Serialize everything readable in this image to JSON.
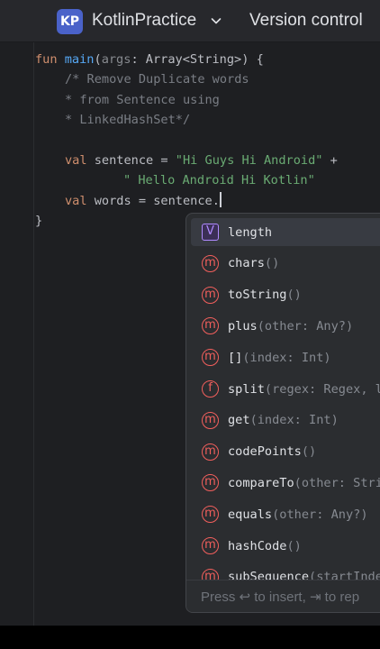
{
  "titlebar": {
    "project_badge": "KP",
    "project_name": "KotlinPractice",
    "project_chevron_icon": "chevron-down-icon",
    "vcs_label": "Version control"
  },
  "editor": {
    "lines": [
      [
        {
          "t": "fun ",
          "c": "kw"
        },
        {
          "t": "main",
          "c": "fn"
        },
        {
          "t": "(",
          "c": ""
        },
        {
          "t": "args",
          "c": "param"
        },
        {
          "t": ": Array<String>) {",
          "c": ""
        }
      ],
      [
        {
          "t": "/* Remove Duplicate words",
          "c": "cmt"
        }
      ],
      [
        {
          "t": "* from Sentence using",
          "c": "cmt"
        }
      ],
      [
        {
          "t": "* LinkedHashSet*/",
          "c": "cmt"
        }
      ],
      [],
      [
        {
          "t": "val ",
          "c": "kw"
        },
        {
          "t": "sentence = ",
          "c": ""
        },
        {
          "t": "\"Hi Guys Hi Android\"",
          "c": "str"
        },
        {
          "t": " +",
          "c": ""
        }
      ],
      [
        {
          "t": "\" Hello Android Hi Kotlin\"",
          "c": "str"
        }
      ],
      [
        {
          "t": "val ",
          "c": "kw"
        },
        {
          "t": "words = sentence.",
          "c": ""
        }
      ],
      [
        {
          "t": "}",
          "c": ""
        }
      ]
    ]
  },
  "completion": {
    "items": [
      {
        "kind": "v",
        "name": "length",
        "tail": ""
      },
      {
        "kind": "m",
        "name": "chars",
        "tail": "()"
      },
      {
        "kind": "m",
        "name": "toString",
        "tail": "()"
      },
      {
        "kind": "m",
        "name": "plus",
        "tail": "(other: Any?)"
      },
      {
        "kind": "m",
        "name": "[]",
        "tail": "(index: Int)"
      },
      {
        "kind": "f",
        "name": "split",
        "tail": "(regex: Regex, l"
      },
      {
        "kind": "m",
        "name": "get",
        "tail": "(index: Int)"
      },
      {
        "kind": "m",
        "name": "codePoints",
        "tail": "()"
      },
      {
        "kind": "m",
        "name": "compareTo",
        "tail": "(other: Stri"
      },
      {
        "kind": "m",
        "name": "equals",
        "tail": "(other: Any?)"
      },
      {
        "kind": "m",
        "name": "hashCode",
        "tail": "()"
      },
      {
        "kind": "m",
        "name": "subSequence",
        "tail": "(startInde"
      }
    ],
    "footer_hint": "Press ↩ to insert, ⇥ to rep"
  }
}
